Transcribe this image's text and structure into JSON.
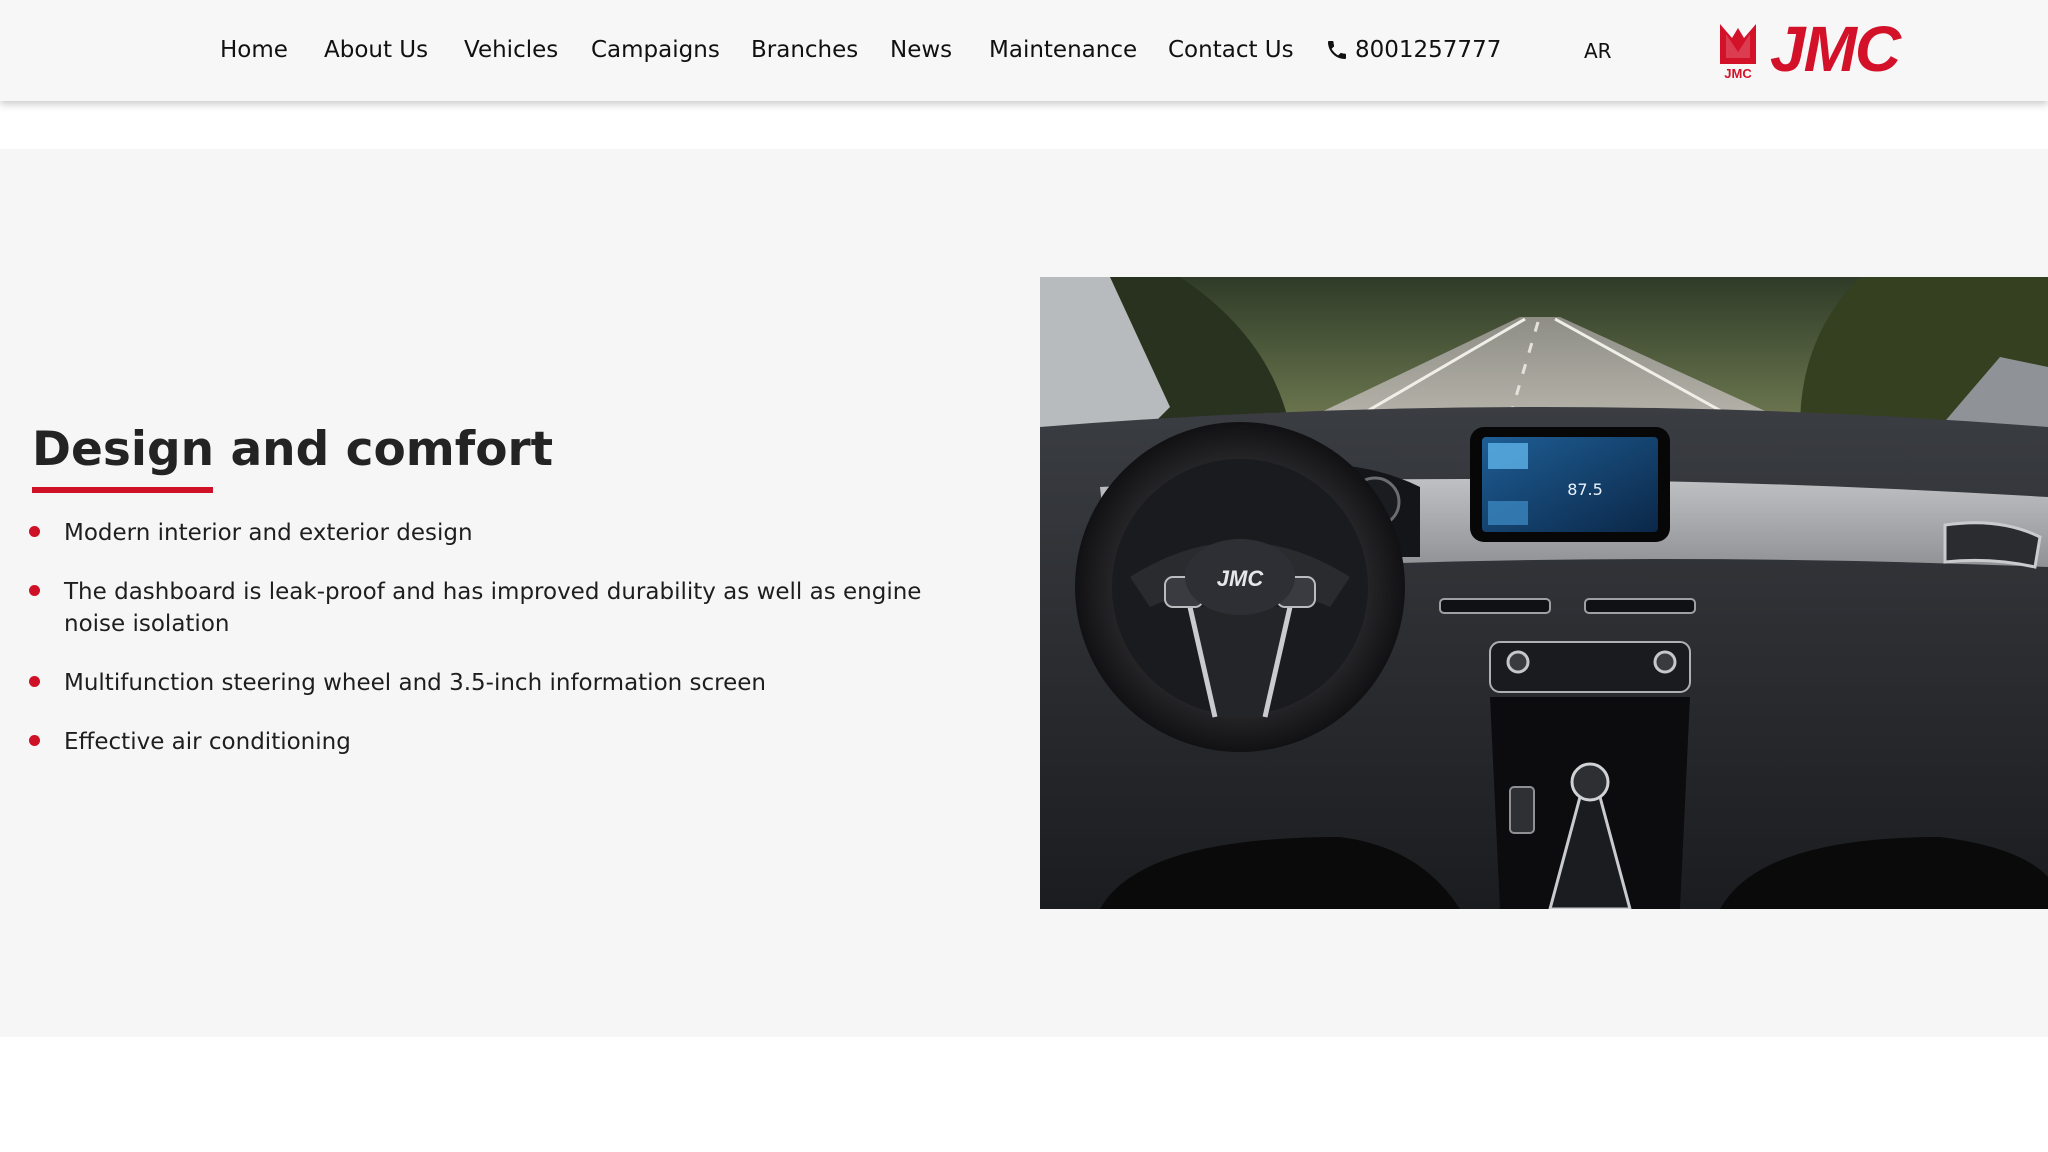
{
  "nav": {
    "items": [
      {
        "label": "Home"
      },
      {
        "label": "About Us"
      },
      {
        "label": "Vehicles"
      },
      {
        "label": "Campaigns"
      },
      {
        "label": "Branches"
      },
      {
        "label": "News"
      },
      {
        "label": "Maintenance"
      },
      {
        "label": "Contact Us"
      }
    ],
    "phone": {
      "icon": "phone-icon",
      "number": "8001257777"
    },
    "language": "AR"
  },
  "brand": {
    "name": "JMC",
    "badge_text": "JMC",
    "color": "#d3122a"
  },
  "feature": {
    "title": "Design and comfort",
    "accent_color": "#cf1127",
    "bullets": [
      "Modern interior and exterior design",
      "The dashboard is leak-proof and has improved durability as well as engine noise isolation",
      "Multifunction steering wheel and 3.5-inch information screen",
      "Effective air conditioning"
    ],
    "image": {
      "steering_badge": "JMC",
      "screen_readout": "87.5"
    }
  }
}
